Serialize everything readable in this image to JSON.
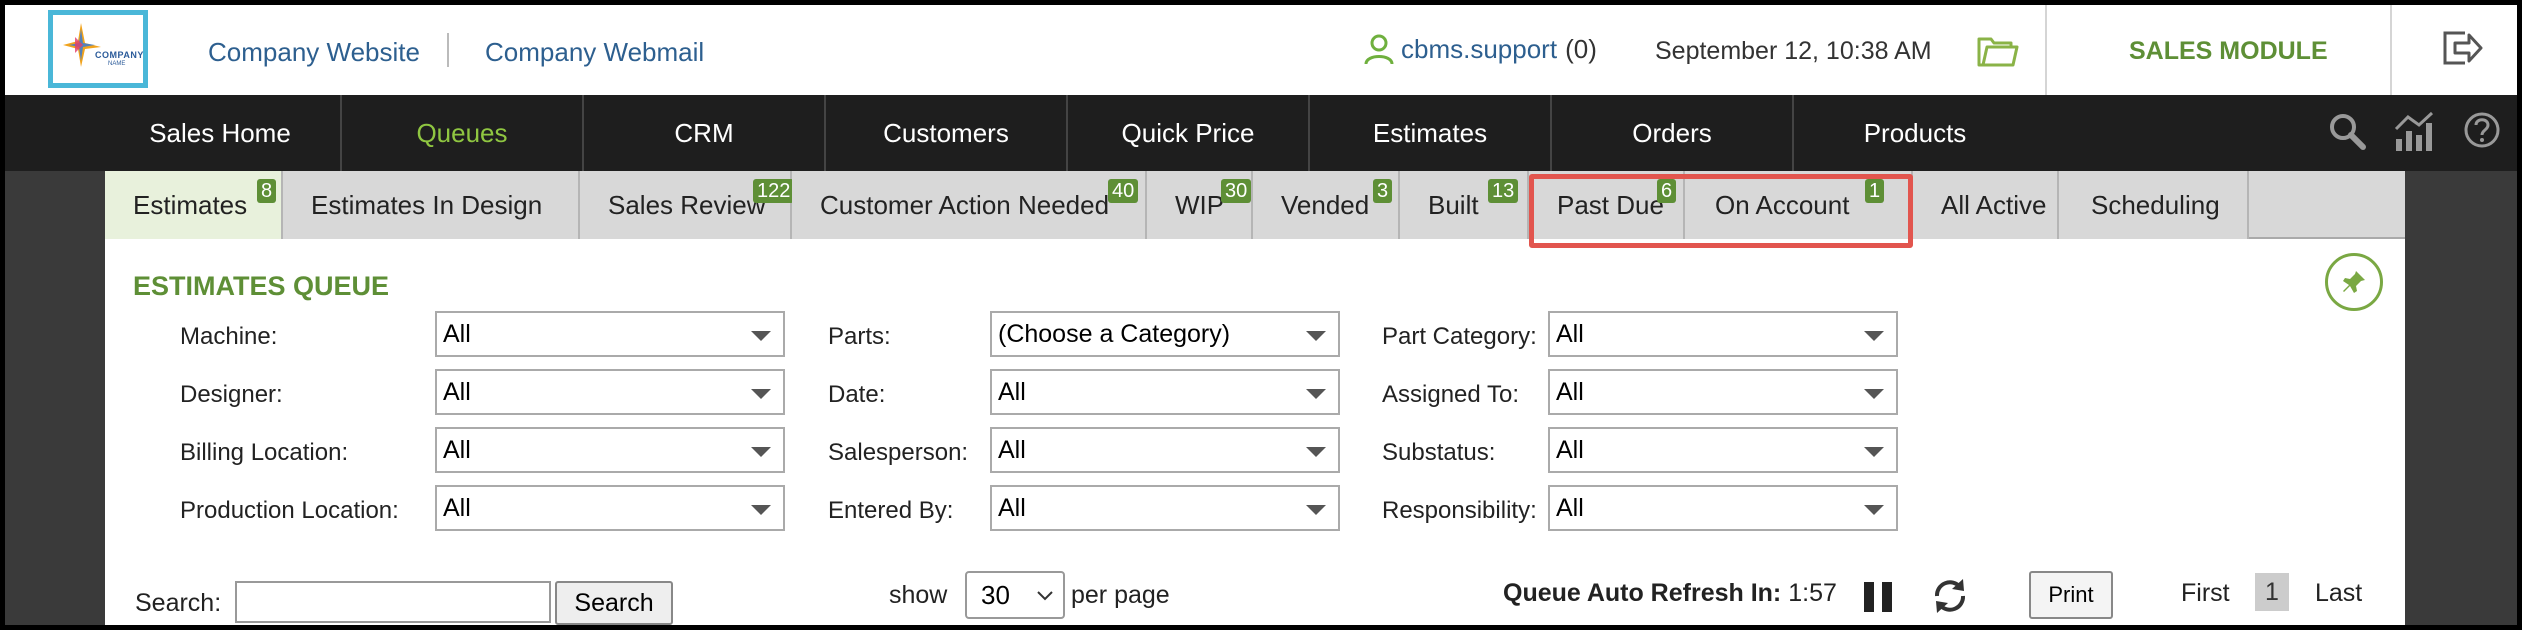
{
  "header": {
    "logo_text": "COMPANY",
    "logo_sub": "NAME",
    "links": [
      "Company Website",
      "Company Webmail"
    ],
    "user_name": "cbms.support",
    "user_count": "(0)",
    "datetime": "September 12, 10:38 AM",
    "module": "SALES MODULE"
  },
  "nav": {
    "items": [
      "Sales Home",
      "Queues",
      "CRM",
      "Customers",
      "Quick Price",
      "Estimates",
      "Orders",
      "Products"
    ],
    "active": "Queues"
  },
  "tabs": [
    {
      "label": "Estimates",
      "badge": "8"
    },
    {
      "label": "Estimates In Design",
      "badge": ""
    },
    {
      "label": "Sales Review",
      "badge": "122"
    },
    {
      "label": "Customer Action Needed",
      "badge": "40"
    },
    {
      "label": "WIP",
      "badge": "30"
    },
    {
      "label": "Vended",
      "badge": "3"
    },
    {
      "label": "Built",
      "badge": "13"
    },
    {
      "label": "Past Due",
      "badge": "6"
    },
    {
      "label": "On Account",
      "badge": "1"
    },
    {
      "label": "All Active",
      "badge": ""
    },
    {
      "label": "Scheduling",
      "badge": ""
    }
  ],
  "queue": {
    "title": "ESTIMATES QUEUE",
    "filters": {
      "col1": [
        {
          "label": "Machine:",
          "value": "All"
        },
        {
          "label": "Designer:",
          "value": "All"
        },
        {
          "label": "Billing Location:",
          "value": "All"
        },
        {
          "label": "Production Location:",
          "value": "All"
        }
      ],
      "col2": [
        {
          "label": "Parts:",
          "value": "(Choose a Category)"
        },
        {
          "label": "Date:",
          "value": "All"
        },
        {
          "label": "Salesperson:",
          "value": "All"
        },
        {
          "label": "Entered By:",
          "value": "All"
        }
      ],
      "col3": [
        {
          "label": "Part Category:",
          "value": "All"
        },
        {
          "label": "Assigned To:",
          "value": "All"
        },
        {
          "label": "Substatus:",
          "value": "All"
        },
        {
          "label": "Responsibility:",
          "value": "All"
        }
      ]
    },
    "search_label": "Search:",
    "search_value": "",
    "search_button": "Search",
    "show_label": "show",
    "per_page_value": "30",
    "per_page_label": "per page",
    "refresh_label": "Queue Auto Refresh In:",
    "refresh_value": "1:57",
    "print_button": "Print",
    "pager_first": "First",
    "pager_current": "1",
    "pager_last": "Last"
  },
  "colors": {
    "accent_green": "#5e8f36",
    "nav_active": "#8fc641",
    "highlight_red": "#e2554e",
    "link_blue": "#2d5f8f"
  }
}
